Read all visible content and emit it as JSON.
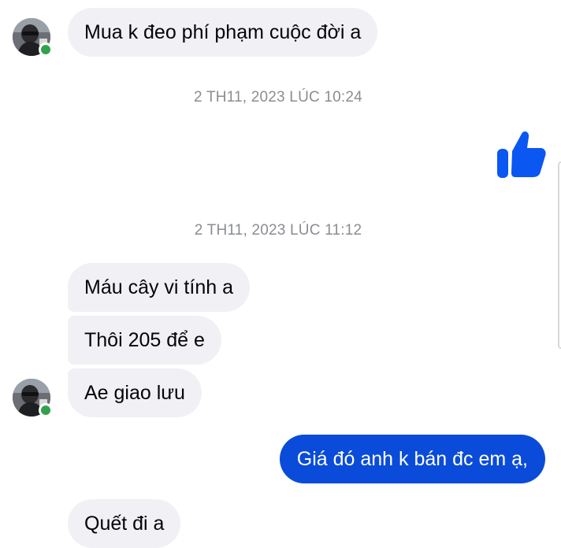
{
  "conversation": {
    "messages": [
      {
        "text": "Mua k đeo phí phạm cuộc đời a",
        "direction": "incoming"
      },
      {
        "text": "Máu cây vi tính a",
        "direction": "incoming"
      },
      {
        "text": "Thôi 205 để e",
        "direction": "incoming"
      },
      {
        "text": "Ae giao lưu",
        "direction": "incoming"
      },
      {
        "text": "Giá đó anh k bán đc em ạ,",
        "direction": "outgoing"
      },
      {
        "text": "Quết đi a",
        "direction": "incoming"
      }
    ],
    "timestamps": [
      "2 TH11, 2023 LÚC 10:24",
      "2 TH11, 2023 LÚC 11:12"
    ],
    "reaction": {
      "icon": "thumbs-up-icon",
      "direction": "outgoing"
    }
  },
  "colors": {
    "incoming_bubble": "#f0f0f5",
    "outgoing_bubble": "#0a4cd9",
    "like_icon": "#0a57f2",
    "online_indicator": "#31a24c",
    "timestamp_text": "#8a8d91"
  },
  "contact": {
    "avatar_icon": "contact-avatar-icon",
    "online": true
  }
}
